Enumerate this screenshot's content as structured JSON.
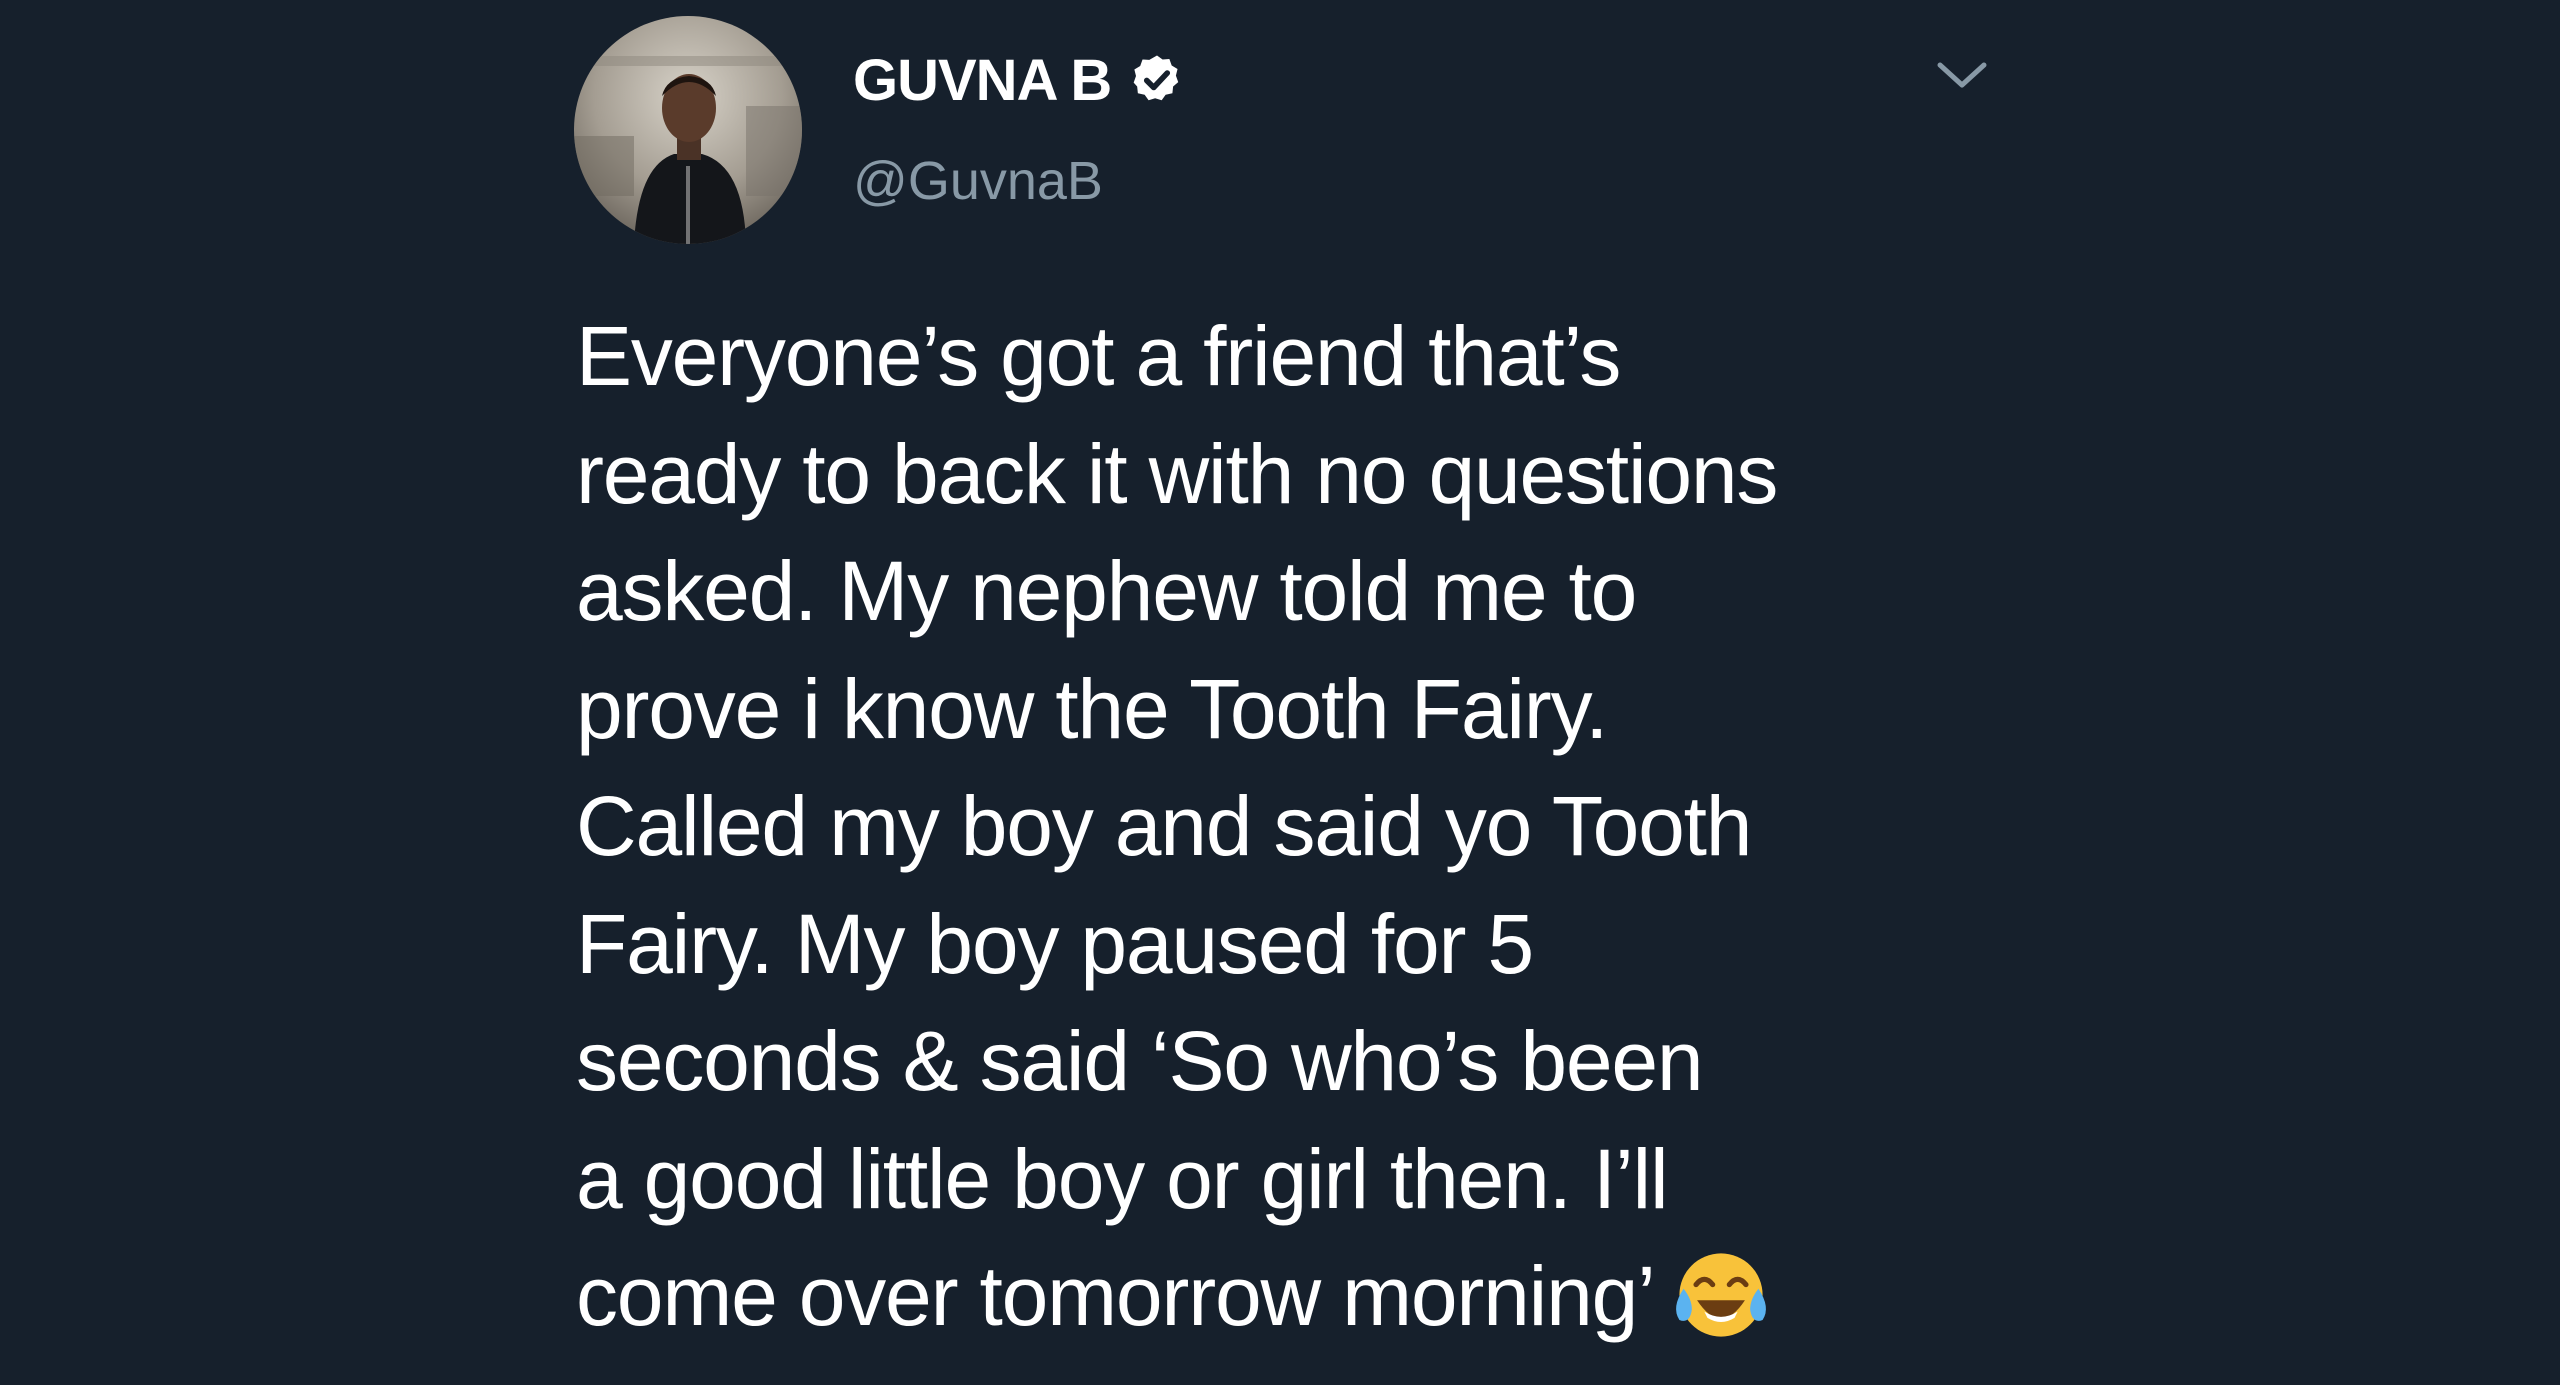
{
  "tweet": {
    "author": {
      "display_name": "GUVNA B",
      "handle": "@GuvnaB",
      "verified": true,
      "avatar_icon": "profile-photo",
      "verified_icon": "verified-badge-icon"
    },
    "menu_icon": "chevron-down-icon",
    "text_lines": [
      "Everyone’s got a friend that’s",
      "ready to back it with no questions",
      "asked. My nephew told me to",
      "prove i know the Tooth Fairy.",
      "Called my boy and said yo Tooth",
      "Fairy. My boy paused for 5",
      "seconds & said ‘So who’s been",
      "a good little boy or girl then. I’ll",
      "come over tomorrow morning’"
    ],
    "emoji": "face-with-tears-of-joy"
  },
  "colors": {
    "background": "#16202c",
    "text": "#ffffff",
    "secondary_text": "#8899a6"
  }
}
